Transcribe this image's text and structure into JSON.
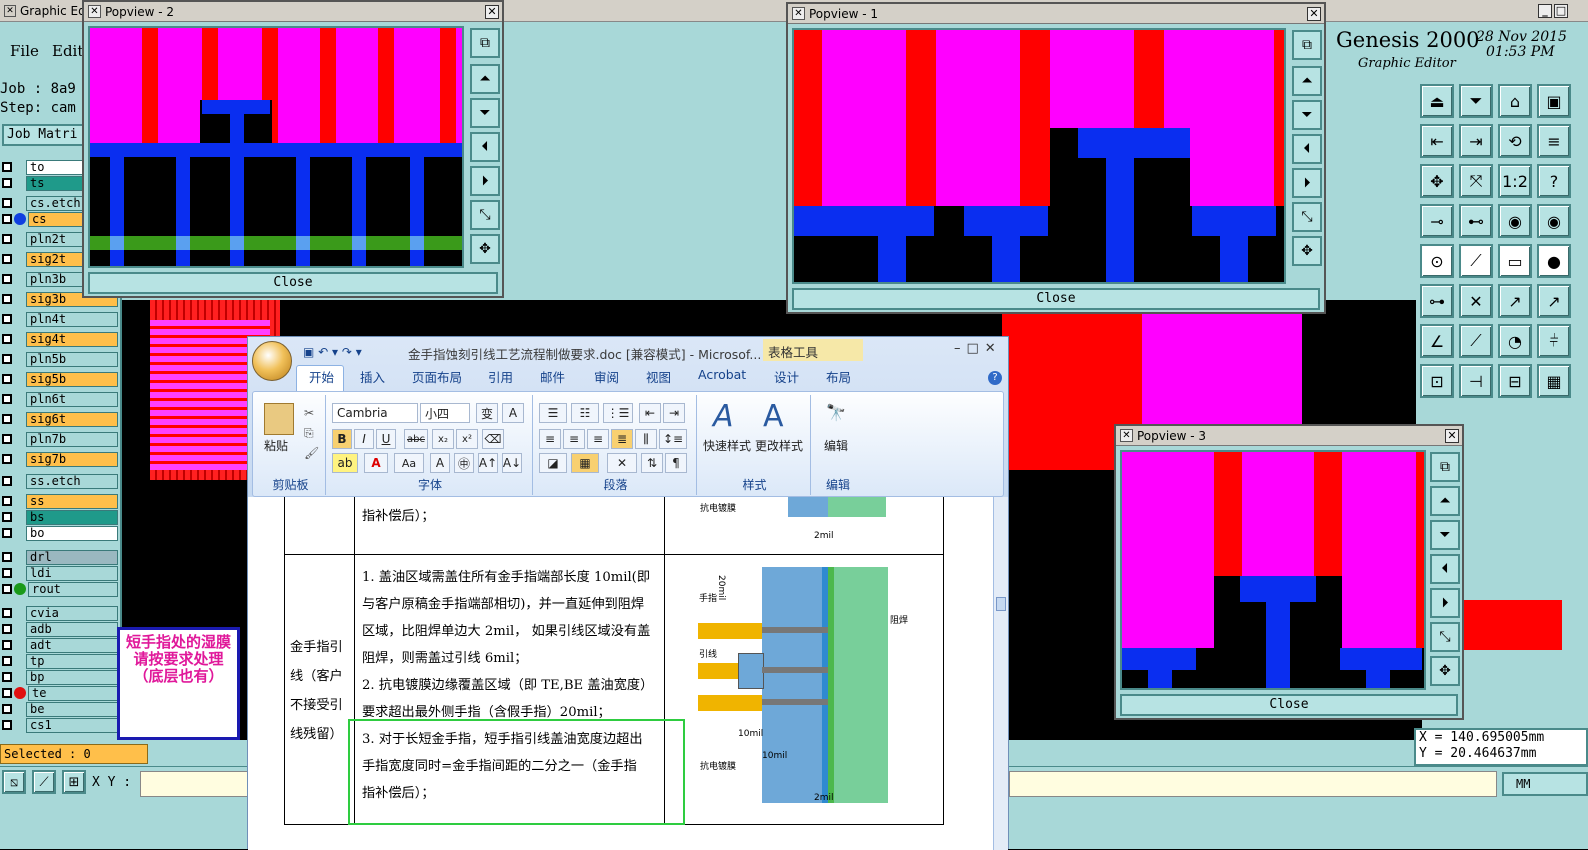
{
  "genesis": {
    "title": "Graphic Editor",
    "menu": {
      "file": "File",
      "edit": "Edit"
    },
    "job_label": "Job : 8a9",
    "step_label": "Step: cam",
    "job_matrix": "Job Matri",
    "brand": "Genesis 2000",
    "subtitle": "Graphic Editor",
    "date": "28 Nov 2015",
    "time": "01:53 PM",
    "layers": [
      {
        "name": "to",
        "bg": "#ffffff"
      },
      {
        "name": "ts",
        "bg": "#1f9a8a"
      },
      {
        "name": "cs.etch",
        "bg": "#a8d8d8"
      },
      {
        "name": "cs",
        "bg": "#ffbf4a",
        "dot": "#1040e0"
      },
      {
        "name": "pln2t",
        "bg": "#a8d8d8"
      },
      {
        "name": "sig2t",
        "bg": "#ffbf4a"
      },
      {
        "name": "pln3b",
        "bg": "#a8d8d8"
      },
      {
        "name": "sig3b",
        "bg": "#ffbf4a"
      },
      {
        "name": "pln4t",
        "bg": "#a8d8d8"
      },
      {
        "name": "sig4t",
        "bg": "#ffbf4a"
      },
      {
        "name": "pln5b",
        "bg": "#a8d8d8"
      },
      {
        "name": "sig5b",
        "bg": "#ffbf4a"
      },
      {
        "name": "pln6t",
        "bg": "#a8d8d8"
      },
      {
        "name": "sig6t",
        "bg": "#ffbf4a"
      },
      {
        "name": "pln7b",
        "bg": "#a8d8d8"
      },
      {
        "name": "sig7b",
        "bg": "#ffbf4a"
      },
      {
        "name": "ss.etch",
        "bg": "#a8d8d8"
      },
      {
        "name": "ss",
        "bg": "#ffbf4a"
      },
      {
        "name": "bs",
        "bg": "#1f9a8a"
      },
      {
        "name": "bo",
        "bg": "#ffffff"
      },
      {
        "name": "drl",
        "bg": "#9ab8c0"
      },
      {
        "name": "ldi",
        "bg": "#a8d8d8"
      },
      {
        "name": "rout",
        "bg": "#a8d8d8",
        "dot": "#1a9a1a"
      },
      {
        "name": "cvia",
        "bg": "#a8d8d8"
      },
      {
        "name": "adb",
        "bg": "#a8d8d8"
      },
      {
        "name": "adt",
        "bg": "#a8d8d8"
      },
      {
        "name": "tp",
        "bg": "#a8d8d8"
      },
      {
        "name": "bp",
        "bg": "#a8d8d8"
      },
      {
        "name": "te",
        "bg": "#a8d8d8",
        "dot": "#e01010"
      },
      {
        "name": "be",
        "bg": "#a8d8d8"
      },
      {
        "name": "cs1",
        "bg": "#a8d8d8"
      }
    ],
    "selected": "Selected : 0",
    "xy_label": "X Y :",
    "coord_x": "X = 140.695005mm",
    "coord_y": "Y = 20.464637mm",
    "units": "MM",
    "note": "短手指处的湿膜请按要求处理（底层也有）"
  },
  "popviews": {
    "p1_title": "Popview - 1",
    "p2_title": "Popview - 2",
    "p3_title": "Popview - 3",
    "close": "Close"
  },
  "word": {
    "title": "金手指蚀刻引线工艺流程制做要求.doc [兼容模式] - Microsof...",
    "context_tab": "表格工具",
    "tabs": [
      "开始",
      "插入",
      "页面布局",
      "引用",
      "邮件",
      "审阅",
      "视图",
      "Acrobat",
      "设计",
      "布局"
    ],
    "font_name": "Cambria",
    "font_size": "小四",
    "groups": {
      "clipboard": "剪贴板",
      "font": "字体",
      "paragraph": "段落",
      "styles": "样式",
      "edit": "编辑"
    },
    "buttons": {
      "paste": "粘贴",
      "quick_style": "快速样式",
      "change_style": "更改样式",
      "edit": "编辑"
    },
    "doc": {
      "prev_tail": "指补偿后）；",
      "row_label": [
        "金手指引",
        "线（客户",
        "不接受引",
        "线残留）"
      ],
      "p1": [
        "1. 盖油区域需盖住所有金手指端部长度 10mil(即",
        "与客户原稿金手指端部相切)，并一直延伸到阻焊",
        "区域，比阻焊单边大 2mil， 如果引线区域没有盖",
        "阻焊，则需盖过引线 6mil；"
      ],
      "p2": [
        "2. 抗电镀膜边缘覆盖区域（即 TE,BE 盖油宽度）",
        "要求超出最外侧手指（含假手指）20mil；"
      ],
      "p3": [
        "3. 对于长短金手指，短手指引线盖油宽度边超出",
        "手指宽度同时=金手指间距的二分之一（金手指",
        "指补偿后）；"
      ],
      "fig_labels": {
        "finger": "手指",
        "lead": "引线",
        "mask": "阻焊",
        "film": "抗电镀膜",
        "d20": "20mil",
        "d10a": "10mil",
        "d10b": "10mil",
        "d2": "2mil",
        "d2top": "2mil",
        "film_top": "抗电镀膜"
      }
    }
  }
}
